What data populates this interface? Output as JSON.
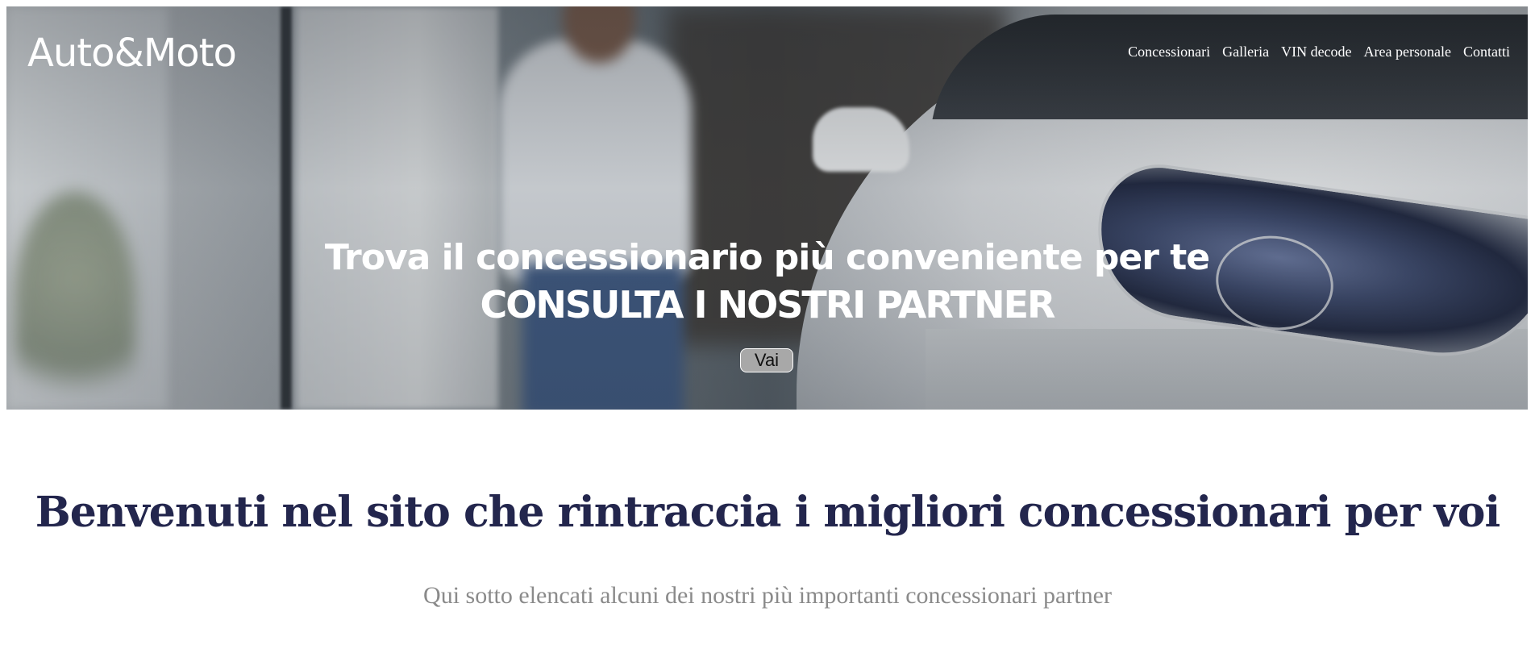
{
  "header": {
    "logo": "Auto&Moto",
    "nav": [
      {
        "label": "Concessionari"
      },
      {
        "label": "Galleria"
      },
      {
        "label": "VIN decode"
      },
      {
        "label": "Area personale"
      },
      {
        "label": "Contatti"
      }
    ]
  },
  "hero": {
    "line1": "Trova il concessionario più conveniente per te",
    "line2": "CONSULTA I NOSTRI PARTNER",
    "button_label": "Vai"
  },
  "main": {
    "title": "Benvenuti nel sito che rintraccia i migliori concessionari per voi",
    "subtitle": "Qui sotto elencati alcuni dei nostri più importanti concessionari partner"
  }
}
